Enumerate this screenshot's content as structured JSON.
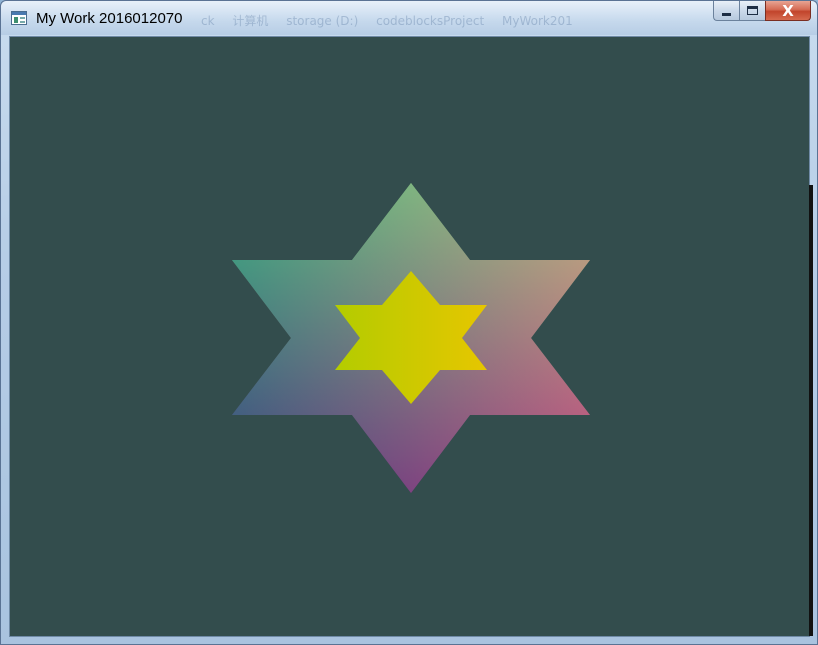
{
  "window": {
    "title": "My Work 2016012070",
    "close_glyph": "X",
    "icons": [
      "app-icon",
      "minimize-icon",
      "maximize-icon",
      "close-icon"
    ]
  },
  "background_path": [
    "ck",
    "计算机",
    "storage (D:)",
    "codeblocksProject",
    "MyWork201"
  ],
  "canvas": {
    "clear_color": "#334d4d",
    "outer_star": {
      "shape": "hexagram",
      "vertex_colors": [
        "#7fff7f",
        "#e6b880",
        "#e6407f",
        "#800080",
        "#0d3380",
        "#19bf80"
      ]
    },
    "inner_star": {
      "shape": "hexagram",
      "fill_gradient": [
        "#b3cc00",
        "#e6c600"
      ]
    }
  }
}
